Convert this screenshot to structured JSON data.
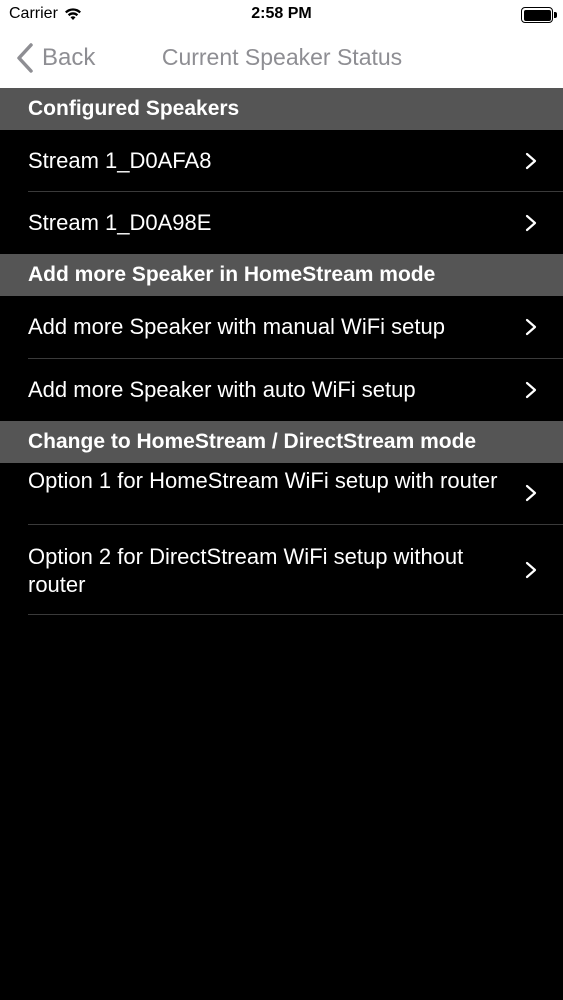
{
  "status_bar": {
    "carrier": "Carrier",
    "time": "2:58 PM"
  },
  "nav": {
    "back_label": "Back",
    "title": "Current Speaker Status"
  },
  "sections": [
    {
      "header": "Configured Speakers",
      "rows": [
        "Stream 1_D0AFA8",
        "Stream 1_D0A98E"
      ]
    },
    {
      "header": "Add more Speaker in HomeStream mode",
      "rows": [
        "Add more Speaker with manual WiFi setup",
        "Add more Speaker with auto WiFi setup"
      ]
    },
    {
      "header": "Change to HomeStream / DirectStream mode",
      "rows": [
        "Option 1 for HomeStream WiFi setup with router",
        "Option 2 for DirectStream WiFi setup without router"
      ]
    }
  ],
  "colors": {
    "background": "#000000",
    "section_header": "#555555",
    "nav_text": "#8e8e93"
  },
  "icons": [
    "wifi-icon",
    "battery-icon",
    "back-chevron-icon",
    "chevron-right-icon"
  ]
}
